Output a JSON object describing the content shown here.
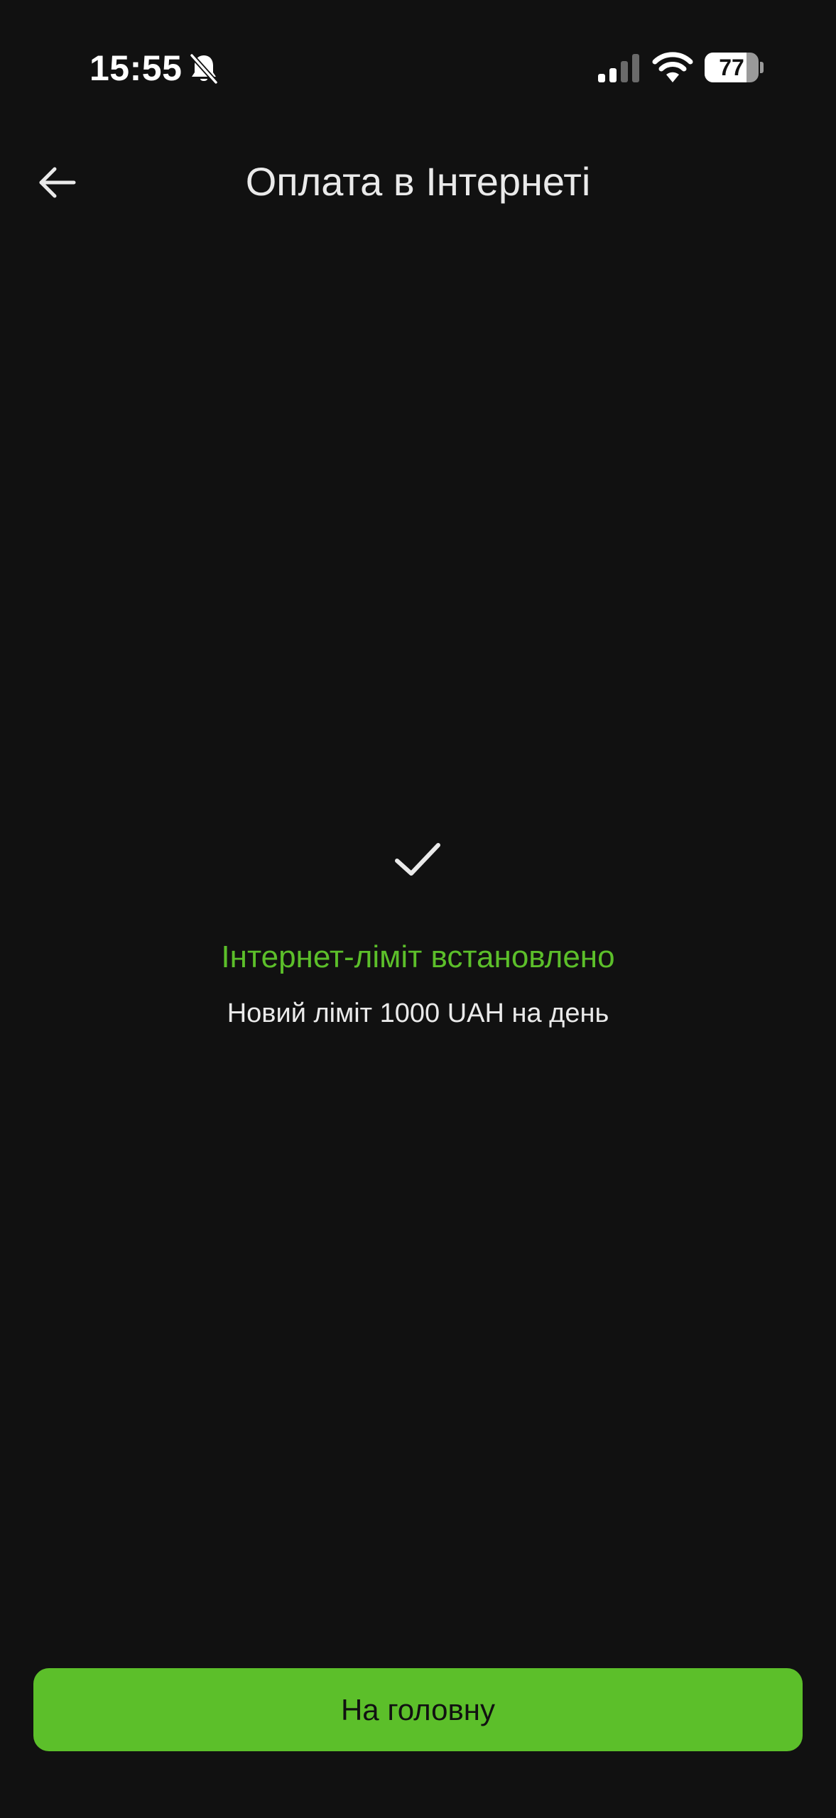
{
  "status_bar": {
    "time": "15:55",
    "battery_level": "77",
    "battery_fraction": 0.77,
    "icons": [
      "bell-muted-icon",
      "signal-icon",
      "wifi-icon",
      "battery-icon"
    ]
  },
  "header": {
    "title": "Оплата в Інтернеті",
    "back_icon": "arrow-left-icon"
  },
  "result": {
    "icon": "checkmark-icon",
    "title": "Інтернет-ліміт встановлено",
    "subtitle": "Новий ліміт 1000 UAH на день"
  },
  "footer": {
    "home_label": "На головну"
  },
  "colors": {
    "background": "#111111",
    "accent": "#5cbf2a",
    "text": "#eaeaea"
  }
}
